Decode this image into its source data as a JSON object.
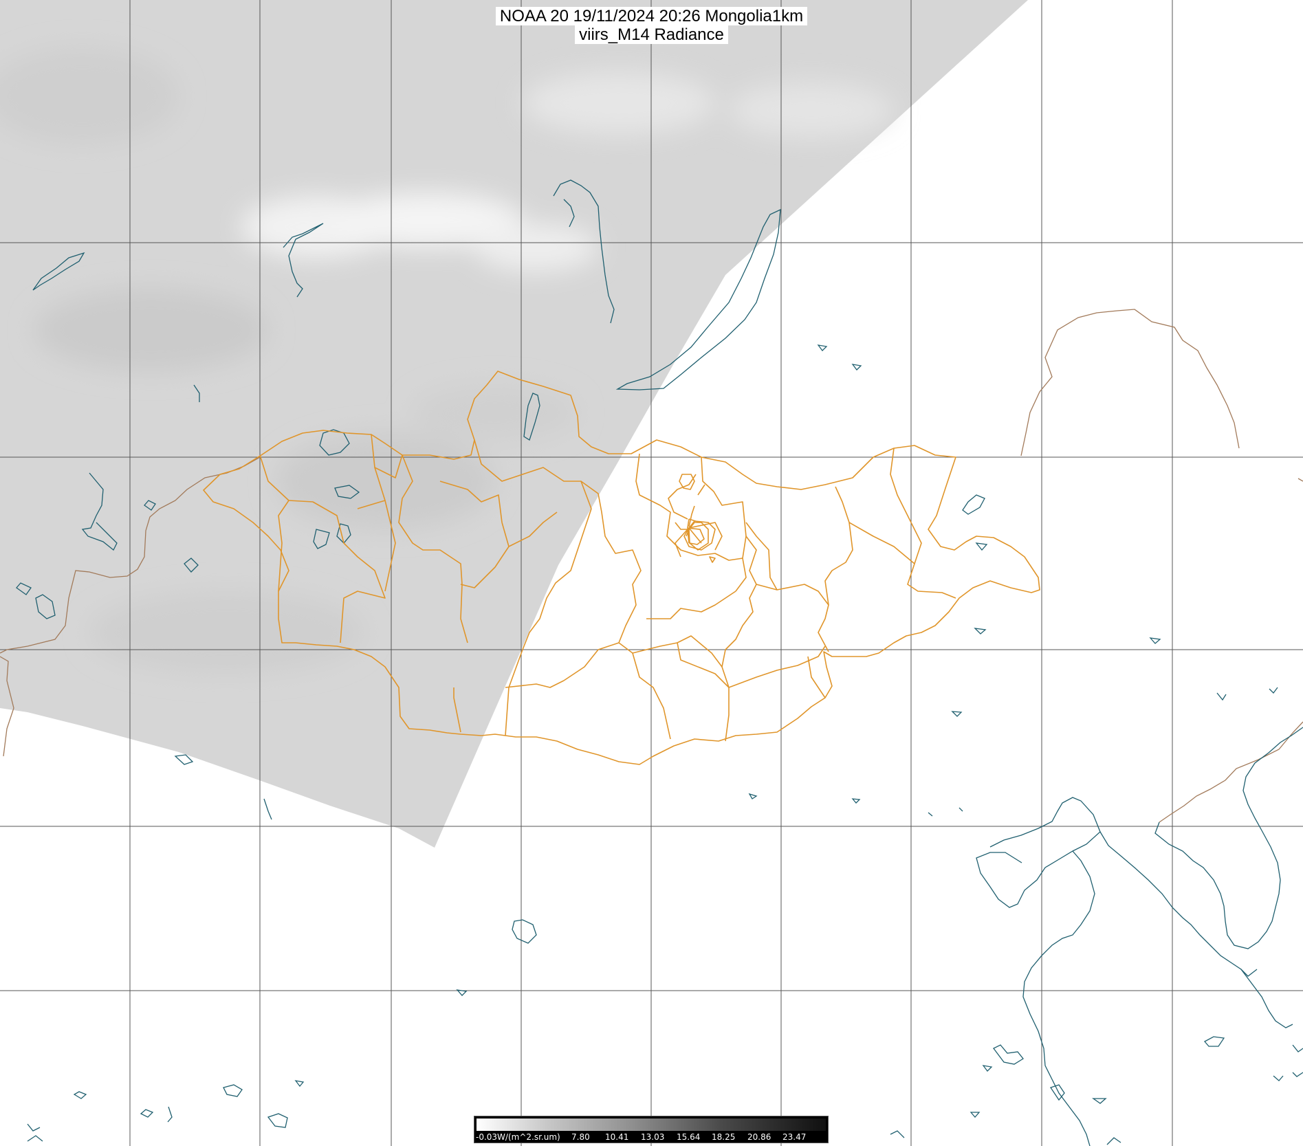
{
  "title": {
    "line1": "NOAA 20 19/11/2024 20:26 Mongolia1km",
    "line2": "viirs_M14 Radiance"
  },
  "colorbar": {
    "unit_label": "-0.03W/(m^2.sr.um)",
    "ticks": [
      "7.80",
      "10.41",
      "13.03",
      "15.64",
      "18.25",
      "20.86",
      "23.47"
    ],
    "colors": {
      "low": "#ffffff",
      "high": "#101010"
    }
  },
  "colors": {
    "swath": "#d6d6d6",
    "grid": "#555555",
    "coast": "#1f5f6f",
    "border_intl": "#a27a5a",
    "mongolia_border": "#e0952a"
  }
}
